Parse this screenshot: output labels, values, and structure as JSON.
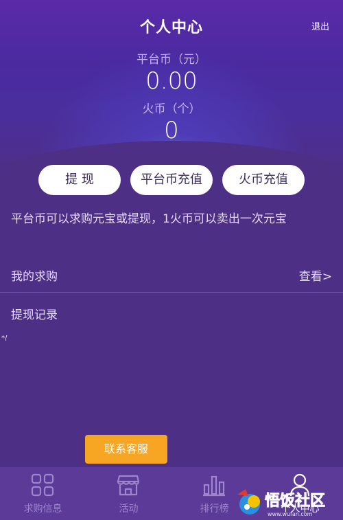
{
  "header": {
    "title": "个人中心",
    "logout_label": "退出"
  },
  "balances": {
    "platform_coin_label": "平台币（元）",
    "platform_coin_value": "0.00",
    "fire_coin_label": "火币（个）",
    "fire_coin_value": "0"
  },
  "actions": {
    "withdraw_label": "提 现",
    "platform_topup_label": "平台币充值",
    "fire_topup_label": "火币充值"
  },
  "note": "平台币可以求购元宝或提现，1火币可以卖出一次元宝",
  "rows": {
    "purchase_label": "我的求购",
    "view_label": "查看>",
    "withdraw_history_label": "提现记录"
  },
  "stray_text": "*/",
  "contact_label": "联系客服",
  "tabs": [
    {
      "label": "求购信息",
      "icon": "grid-icon"
    },
    {
      "label": "活动",
      "icon": "shop-icon"
    },
    {
      "label": "排行榜",
      "icon": "bar-chart-icon"
    },
    {
      "label": "个人中心",
      "icon": "user-icon"
    }
  ],
  "watermark": {
    "text": "悟饭社区",
    "sub": "www.wufan.com"
  },
  "colors": {
    "background": "#4e2f86",
    "button_bg": "#ffffff",
    "contact_button": "#f7a623",
    "tab_inactive": "#9f86cc",
    "tab_active": "#ffffff"
  }
}
